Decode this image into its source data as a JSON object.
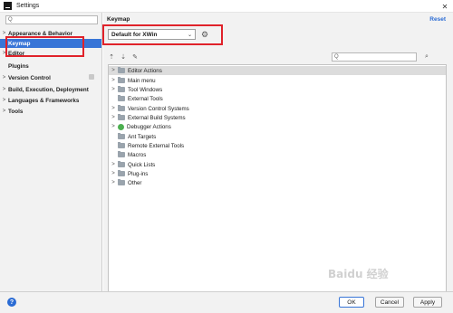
{
  "window": {
    "title": "Settings"
  },
  "search": {
    "placeholder": "Q"
  },
  "sidebar": {
    "items": [
      {
        "label": "Appearance & Behavior",
        "arrow": ">"
      },
      {
        "label": "Keymap",
        "arrow": ""
      },
      {
        "label": "Editor",
        "arrow": ">"
      },
      {
        "label": "Plugins",
        "arrow": ""
      },
      {
        "label": "Version Control",
        "arrow": ">"
      },
      {
        "label": "Build, Execution, Deployment",
        "arrow": ">"
      },
      {
        "label": "Languages & Frameworks",
        "arrow": ">"
      },
      {
        "label": "Tools",
        "arrow": ">"
      }
    ]
  },
  "main": {
    "title": "Keymap",
    "reset_label": "Reset",
    "keymap_selected": "Default for XWin",
    "actions_search_placeholder": "Q",
    "actions": [
      {
        "label": "Editor Actions",
        "arrow": ">",
        "icon": "folder"
      },
      {
        "label": "Main menu",
        "arrow": ">",
        "icon": "folder"
      },
      {
        "label": "Tool Windows",
        "arrow": ">",
        "icon": "folder"
      },
      {
        "label": "External Tools",
        "arrow": "",
        "icon": "folder"
      },
      {
        "label": "Version Control Systems",
        "arrow": ">",
        "icon": "folder"
      },
      {
        "label": "External Build Systems",
        "arrow": ">",
        "icon": "folder"
      },
      {
        "label": "Debugger Actions",
        "arrow": ">",
        "icon": "bug"
      },
      {
        "label": "Ant Targets",
        "arrow": "",
        "icon": "folder"
      },
      {
        "label": "Remote External Tools",
        "arrow": "",
        "icon": "folder"
      },
      {
        "label": "Macros",
        "arrow": "",
        "icon": "folder"
      },
      {
        "label": "Quick Lists",
        "arrow": ">",
        "icon": "folder"
      },
      {
        "label": "Plug-ins",
        "arrow": ">",
        "icon": "folder"
      },
      {
        "label": "Other",
        "arrow": ">",
        "icon": "folder"
      }
    ]
  },
  "footer": {
    "help": "?",
    "ok": "OK",
    "cancel": "Cancel",
    "apply": "Apply"
  },
  "watermark": "Baidu 经验",
  "colors": {
    "selection": "#3875d7",
    "annotation": "#e0222a",
    "link": "#2a6bd4"
  }
}
